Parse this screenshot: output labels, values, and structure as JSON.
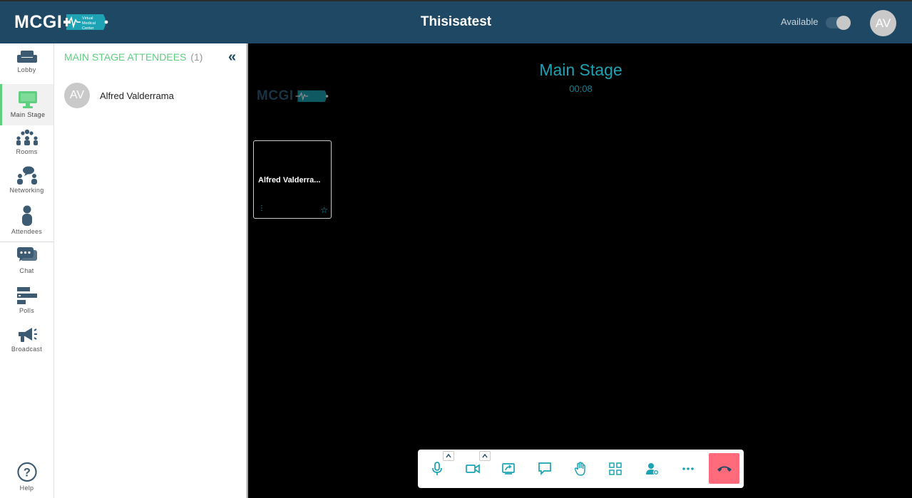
{
  "header": {
    "logo_text": "MCGI",
    "logo_badge_text": "Virtual Medical Center",
    "title": "Thisisatest",
    "status_label": "Available",
    "status_on": true,
    "user_initials": "AV"
  },
  "nav": {
    "items": [
      {
        "label": "Lobby",
        "icon": "couch-icon"
      },
      {
        "label": "Main Stage",
        "icon": "monitor-icon",
        "active": true
      },
      {
        "label": "Rooms",
        "icon": "rooms-icon"
      },
      {
        "label": "Networking",
        "icon": "networking-icon"
      },
      {
        "label": "Attendees",
        "icon": "person-icon"
      },
      {
        "label": "Chat",
        "icon": "chat-icon"
      },
      {
        "label": "Polls",
        "icon": "polls-icon"
      },
      {
        "label": "Broadcast",
        "icon": "megaphone-icon"
      }
    ],
    "help_label": "Help"
  },
  "panel": {
    "title": "MAIN STAGE ATTENDEES",
    "count": "(1)",
    "attendees": [
      {
        "initials": "AV",
        "name": "Alfred Valderrama"
      }
    ]
  },
  "stage": {
    "title": "Main Stage",
    "timer": "00:08",
    "logo_text": "MCGI",
    "tile_name": "Alfred Valderra..."
  },
  "toolbar": {
    "buttons": [
      "microphone-icon",
      "camera-icon",
      "share-screen-icon",
      "chat-bubble-icon",
      "raise-hand-icon",
      "grid-view-icon",
      "add-person-icon",
      "more-icon",
      "hangup-icon"
    ]
  },
  "colors": {
    "header_bg": "#1e4864",
    "accent_green": "#5fcf80",
    "accent_teal": "#1da3b4",
    "hangup": "#ff6b7b",
    "icon_blue": "#3c5b72"
  }
}
